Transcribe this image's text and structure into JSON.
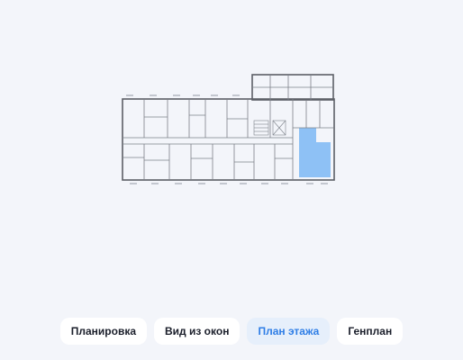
{
  "floor_plan": {
    "highlight_color": "#8ec1f5",
    "wall_color": "#5c5f66"
  },
  "tabs": [
    {
      "label": "Планировка",
      "active": false
    },
    {
      "label": "Вид из окон",
      "active": false
    },
    {
      "label": "План этажа",
      "active": true
    },
    {
      "label": "Генплан",
      "active": false
    }
  ]
}
